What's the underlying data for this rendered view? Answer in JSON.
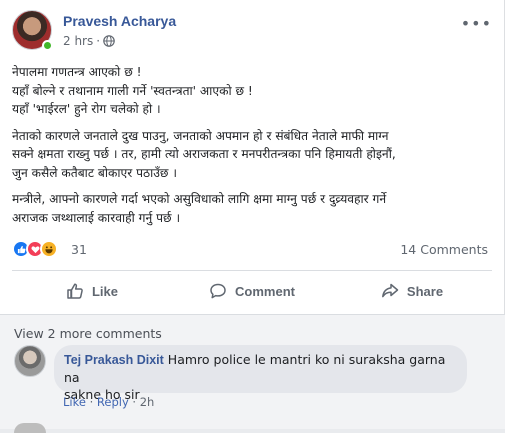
{
  "post": {
    "author": "Pravesh Acharya",
    "time": "2 hrs",
    "separator": "·",
    "more_label": "•••",
    "paragraphs": [
      [
        "नेपालमा गणतन्त्र आएको छ !",
        "यहाँ बोल्ने र तथानाम गाली गर्ने 'स्वतन्त्रता' आएको छ !",
        "यहाँ 'भाईरल' हुने रोग चलेको हो ।"
      ],
      [
        "नेताको कारणले जनताले दुख पाउनु, जनताको अपमान हो र संबंधित नेताले माफी माग्न",
        "सक्ने क्षमता राख्नु पर्छ । तर, हामी त्यो अराजकता र मनपरीतन्त्रका पनि हिमायती होइनौं,",
        "जुन कसैले कतैबाट बोकाएर पठाउँछ ।"
      ],
      [
        "मन्त्रीले, आफ्नो कारणले गर्दा भएको असुविधाको लागि क्षमा माग्नु पर्छ र दुव्र्यवहार गर्ने",
        "अराजक जथ्थालाई कारवाही गर्नु पर्छ ।"
      ]
    ]
  },
  "reactions": {
    "icons": [
      "like-icon",
      "love-icon",
      "haha-icon"
    ],
    "count": "31",
    "comments_count": "14 Comments"
  },
  "actions": {
    "like": "Like",
    "comment": "Comment",
    "share": "Share"
  },
  "comments": {
    "view_more": "View 2 more comments",
    "items": [
      {
        "author": "Tej Prakash Dixit",
        "text": "Hamro police le mantri ko ni suraksha garna na",
        "text2": "sakne ho sir",
        "like": "Like",
        "reply": "Reply",
        "time": "2h"
      }
    ]
  },
  "colors": {
    "link": "#385898",
    "like_blue": "#1877f2",
    "love_red": "#f33e58",
    "haha_yellow": "#f7b125",
    "online_green": "#42b72a"
  }
}
